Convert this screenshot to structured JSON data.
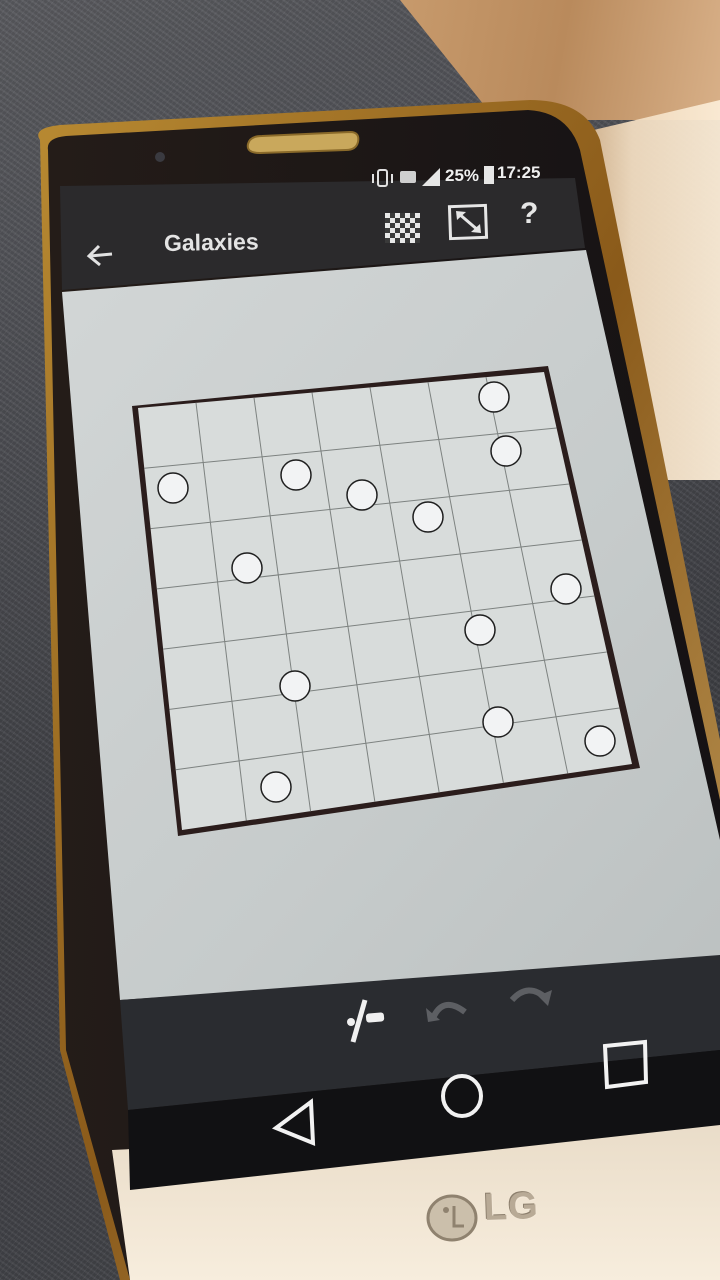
{
  "status_bar": {
    "battery": "25%",
    "time": "17:25",
    "icons": [
      "vibrate-icon",
      "4g-icon",
      "signal-icon",
      "battery-icon"
    ]
  },
  "app_bar": {
    "title": "Galaxies",
    "back_icon": "arrow-left-icon",
    "actions": [
      "checkerboard-icon",
      "resize-icon",
      "help-icon"
    ],
    "help_label": "?"
  },
  "puzzle": {
    "rows": 7,
    "cols": 7,
    "dots_count": 13
  },
  "bottom_toolbar": {
    "tools": [
      "edge-tool-icon",
      "undo-icon",
      "redo-icon"
    ]
  },
  "nav_bar": {
    "buttons": [
      "back-triangle-icon",
      "home-circle-icon",
      "recents-square-icon"
    ]
  },
  "device": {
    "brand": "LG"
  },
  "colors": {
    "app_bar": "#2b2b2d",
    "board": "#d4d9d8",
    "grid_line": "#7d8280",
    "border": "#2a1a1a",
    "dot_fill": "#f2f3f4"
  }
}
